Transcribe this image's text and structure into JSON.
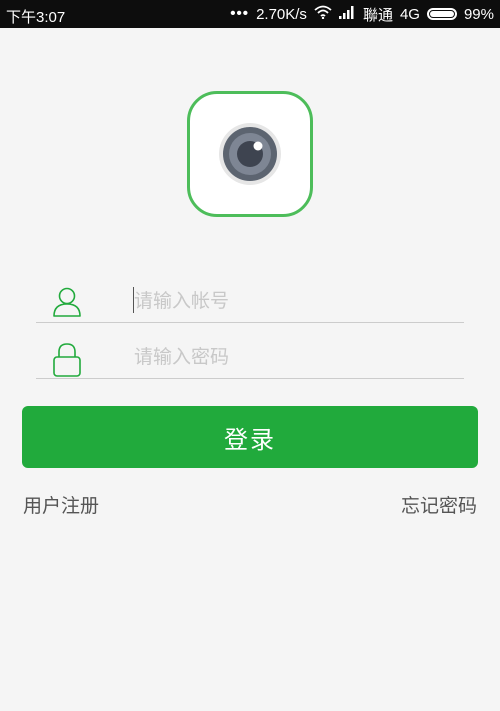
{
  "status_bar": {
    "time": "下午3:07",
    "dots": "•••",
    "network_speed": "2.70K/s",
    "carrier": "聯通",
    "network_type": "4G",
    "battery_percent": "99%",
    "battery_level": 0.99,
    "icons": [
      "wifi-icon",
      "signal-icon",
      "battery-icon"
    ]
  },
  "logo": {
    "icon": "camera-lens-icon",
    "accent": "#4dbd5a"
  },
  "form": {
    "username": {
      "icon": "user-icon",
      "placeholder": "请输入帐号",
      "value": ""
    },
    "password": {
      "icon": "lock-icon",
      "placeholder": "请输入密码",
      "value": ""
    }
  },
  "login_button": {
    "label": "登录",
    "color": "#21aa3c"
  },
  "links": {
    "register": "用户注册",
    "forgot_password": "忘记密码"
  }
}
